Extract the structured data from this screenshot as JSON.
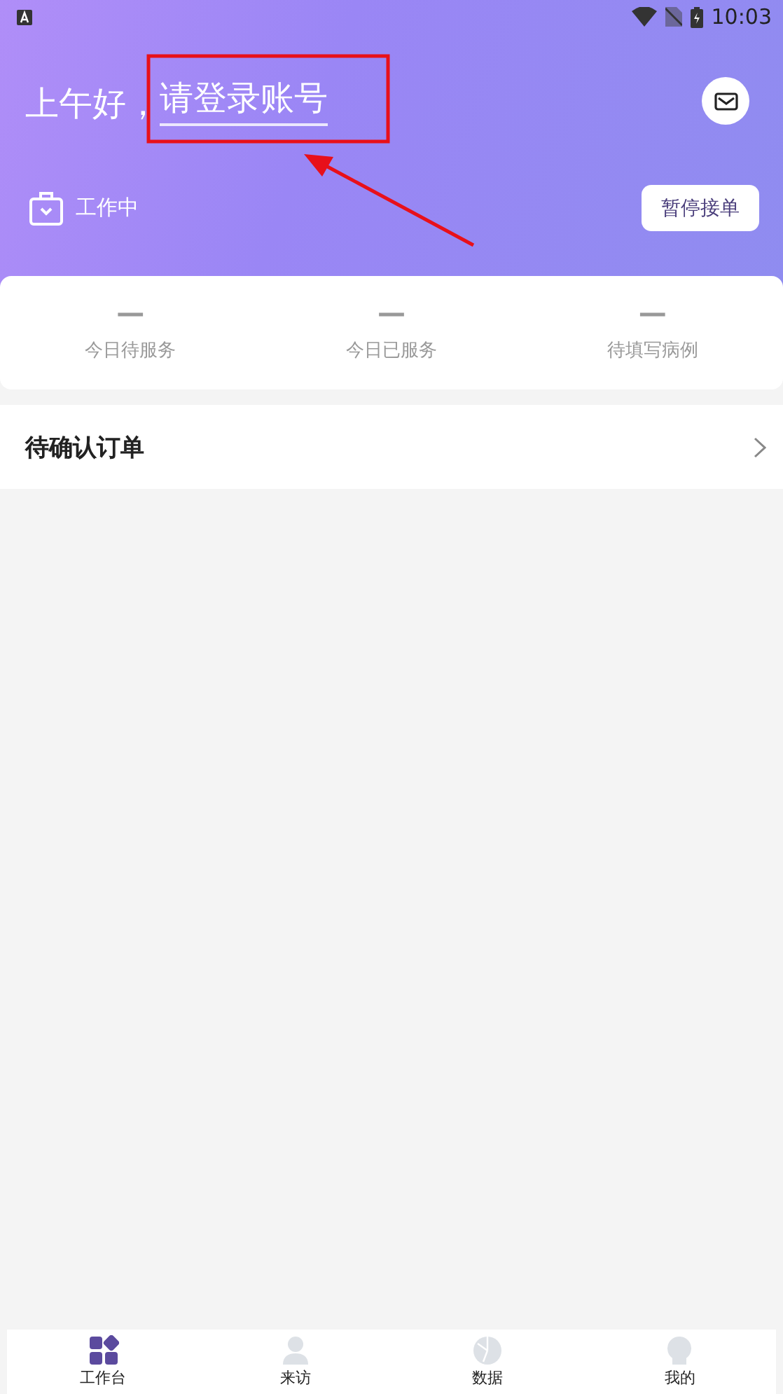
{
  "status_bar": {
    "time": "10:03"
  },
  "header": {
    "greeting": "上午好，",
    "login_link": "请登录账号",
    "work_status": "工作中",
    "pause_button": "暂停接单"
  },
  "stats": [
    {
      "value": "—",
      "label": "今日待服务"
    },
    {
      "value": "—",
      "label": "今日已服务"
    },
    {
      "value": "—",
      "label": "待填写病例"
    }
  ],
  "pending_orders": {
    "title": "待确认订单"
  },
  "nav": [
    {
      "kind": "grid",
      "label": "工作台",
      "selected": true
    },
    {
      "kind": "person",
      "label": "来访",
      "selected": false
    },
    {
      "kind": "pie",
      "label": "数据",
      "selected": false
    },
    {
      "kind": "bulb",
      "label": "我的",
      "selected": false
    }
  ]
}
